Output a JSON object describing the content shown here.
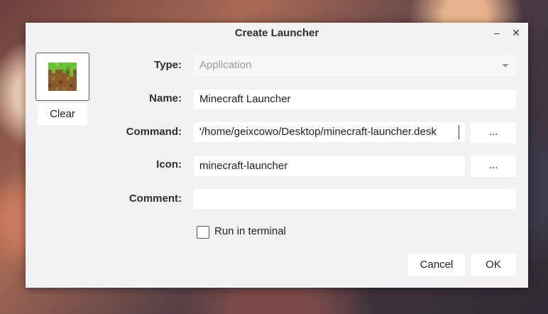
{
  "window": {
    "title": "Create Launcher",
    "minimize_glyph": "–",
    "close_glyph": "✕"
  },
  "icon_preview": {
    "icon": "minecraft-grass-block-icon",
    "clear_label": "Clear"
  },
  "form": {
    "type": {
      "label": "Type:",
      "value": "Application"
    },
    "name": {
      "label": "Name:",
      "value": "Minecraft Launcher"
    },
    "command": {
      "label": "Command:",
      "value": "'/home/geixcowo/Desktop/minecraft-launcher.desk",
      "browse_label": "..."
    },
    "icon": {
      "label": "Icon:",
      "value": "minecraft-launcher",
      "browse_label": "..."
    },
    "comment": {
      "label": "Comment:",
      "value": ""
    },
    "run_in_terminal": {
      "label": "Run in terminal",
      "checked": false
    }
  },
  "actions": {
    "cancel_label": "Cancel",
    "ok_label": "OK"
  },
  "colors": {
    "dialog_bg": "#f2f2f2",
    "field_bg": "#ffffff",
    "text": "#2e2e2e",
    "disabled_text": "#9a9a9a",
    "grass_top": "#6bbf3a",
    "dirt": "#8b5a2b"
  }
}
